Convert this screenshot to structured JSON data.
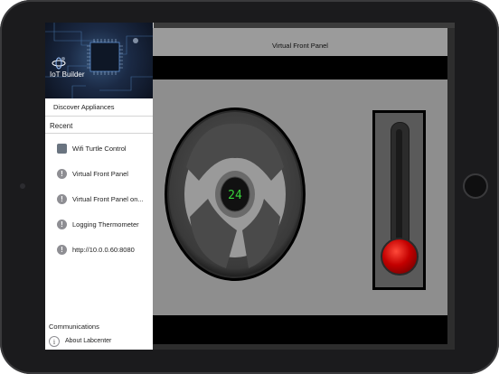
{
  "app": {
    "brand_title": "IoT Builder"
  },
  "sidebar": {
    "discover_label": "Discover Appliances",
    "recent_title": "Recent",
    "recent_items": [
      {
        "label": "Wifi Turtle Control",
        "icon": "turtle-icon"
      },
      {
        "label": "Virtual Front Panel",
        "icon": "alert-icon"
      },
      {
        "label": "Virtual Front Panel on...",
        "icon": "alert-icon"
      },
      {
        "label": "Logging Thermometer",
        "icon": "alert-icon"
      },
      {
        "label": "http://10.0.0.60:8080",
        "icon": "alert-icon"
      }
    ],
    "alert_glyph": "!",
    "communications_label": "Communications",
    "about_label": "About Labcenter",
    "info_glyph": "i"
  },
  "panel": {
    "title": "Virtual Front Panel",
    "dial_value": "24",
    "thermometer_level": 0.0
  },
  "colors": {
    "dial_digits": "#38d23b",
    "bulb": "#d00000",
    "panel_bg": "#8e8e8e"
  }
}
